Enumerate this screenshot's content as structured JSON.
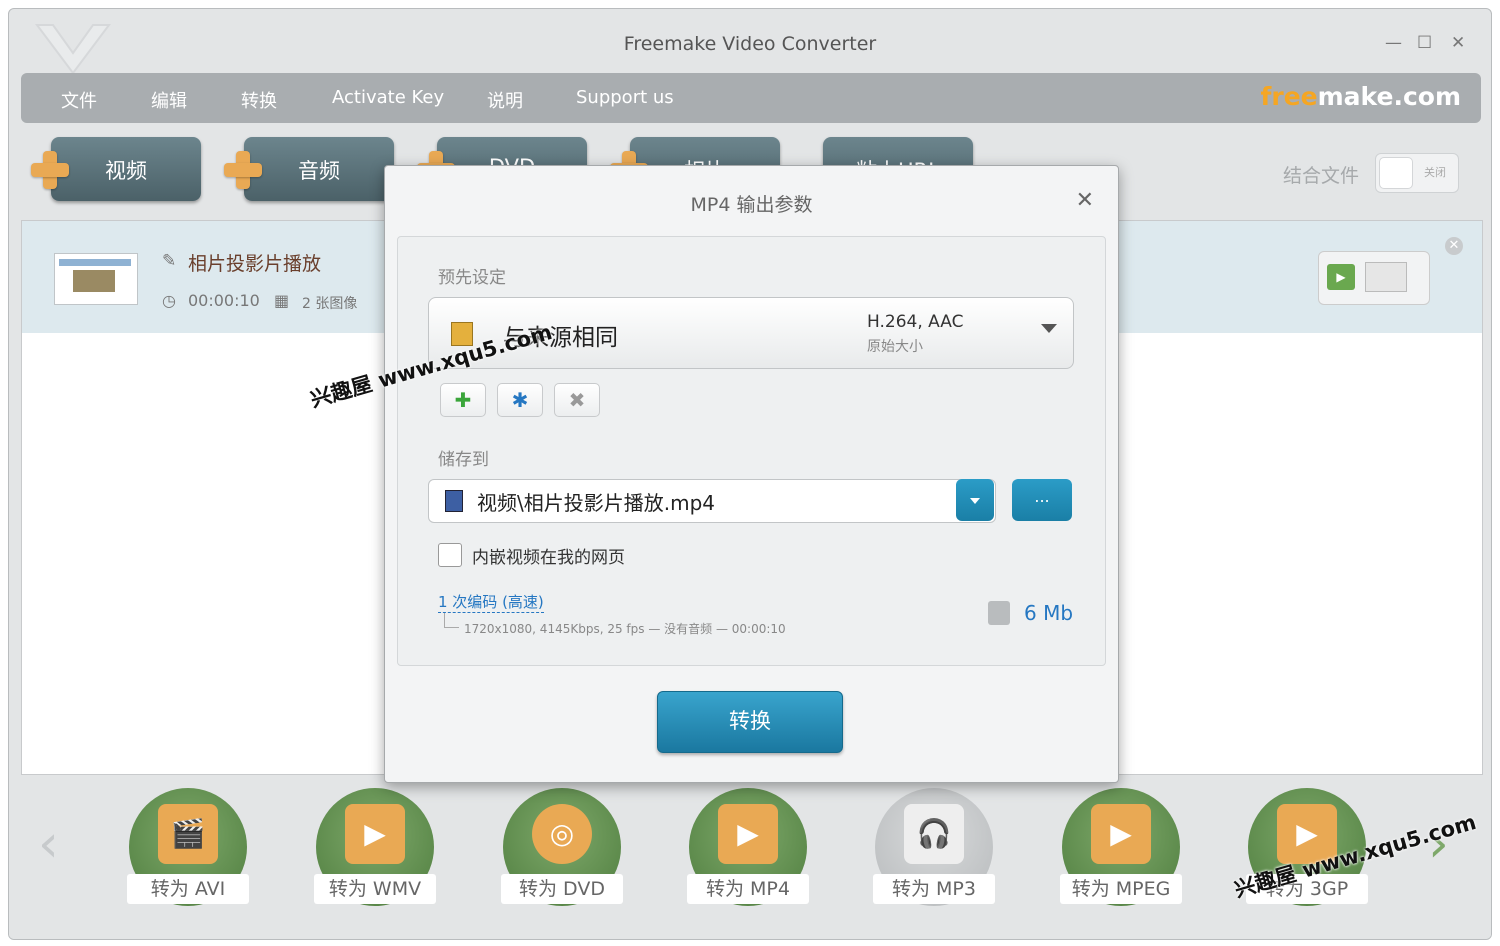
{
  "window": {
    "title": "Freemake Video Converter",
    "minimize": "—",
    "maximize": "☐",
    "close": "✕"
  },
  "menu": {
    "items": [
      "文件",
      "编辑",
      "转换",
      "Activate Key",
      "说明",
      "Support us"
    ],
    "brand_accent": "free",
    "brand_rest": "make.com"
  },
  "add_buttons": [
    "视频",
    "音频",
    "DVD",
    "相片",
    "粘上URL"
  ],
  "join": {
    "label": "结合文件",
    "toggle_text": "关闭"
  },
  "file": {
    "name": "相片投影片播放",
    "duration": "00:00:10",
    "frames": "2 张图像"
  },
  "dialog": {
    "title": "MP4 输出参数",
    "close": "✕",
    "preset_label": "预先设定",
    "preset_name": "与来源相同",
    "preset_codec": "H.264, AAC",
    "preset_size": "原始大小",
    "add_icon": "plus-icon",
    "settings_icon": "gear-icon",
    "delete_icon": "delete-icon",
    "save_label": "储存到",
    "save_path": "视频\\相片投影片播放.mp4",
    "browse": "...",
    "embed_label": "内嵌视频在我的网页",
    "encode_mode": "1 次编码 (高速)",
    "encode_detail": "1720x1080, 4145Kbps, 25 fps — 没有音频 — 00:00:10",
    "size": "6 Mb",
    "convert": "转换"
  },
  "convert_targets": [
    "转为 AVI",
    "转为 WMV",
    "转为 DVD",
    "转为 MP4",
    "转为 MP3",
    "转为 MPEG",
    "转为 3GP"
  ],
  "convert_glyphs": [
    "🎬",
    "▶",
    "◎",
    "▶",
    "🎧",
    "▶",
    "▶"
  ],
  "watermark": "兴趣屋 www.xqu5.com",
  "colors": {
    "accent": "#1a7fa6",
    "convert_green": "#5a8a48",
    "brand_orange": "#f5a623"
  }
}
